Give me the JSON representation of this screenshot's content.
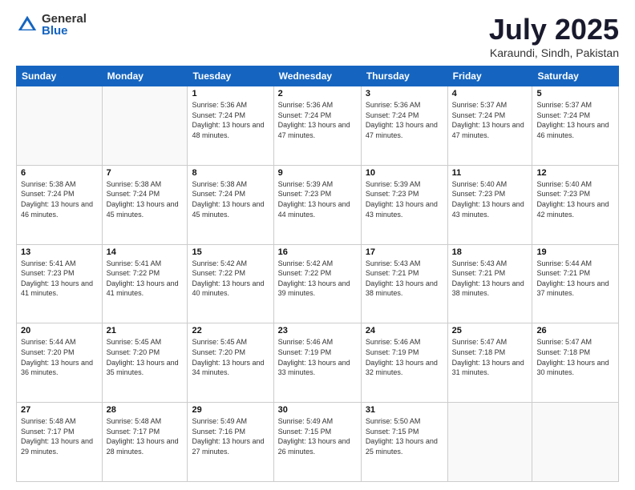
{
  "logo": {
    "general": "General",
    "blue": "Blue"
  },
  "header": {
    "month": "July 2025",
    "location": "Karaundi, Sindh, Pakistan"
  },
  "weekdays": [
    "Sunday",
    "Monday",
    "Tuesday",
    "Wednesday",
    "Thursday",
    "Friday",
    "Saturday"
  ],
  "weeks": [
    [
      {
        "day": "",
        "sunrise": "",
        "sunset": "",
        "daylight": ""
      },
      {
        "day": "",
        "sunrise": "",
        "sunset": "",
        "daylight": ""
      },
      {
        "day": "1",
        "sunrise": "Sunrise: 5:36 AM",
        "sunset": "Sunset: 7:24 PM",
        "daylight": "Daylight: 13 hours and 48 minutes."
      },
      {
        "day": "2",
        "sunrise": "Sunrise: 5:36 AM",
        "sunset": "Sunset: 7:24 PM",
        "daylight": "Daylight: 13 hours and 47 minutes."
      },
      {
        "day": "3",
        "sunrise": "Sunrise: 5:36 AM",
        "sunset": "Sunset: 7:24 PM",
        "daylight": "Daylight: 13 hours and 47 minutes."
      },
      {
        "day": "4",
        "sunrise": "Sunrise: 5:37 AM",
        "sunset": "Sunset: 7:24 PM",
        "daylight": "Daylight: 13 hours and 47 minutes."
      },
      {
        "day": "5",
        "sunrise": "Sunrise: 5:37 AM",
        "sunset": "Sunset: 7:24 PM",
        "daylight": "Daylight: 13 hours and 46 minutes."
      }
    ],
    [
      {
        "day": "6",
        "sunrise": "Sunrise: 5:38 AM",
        "sunset": "Sunset: 7:24 PM",
        "daylight": "Daylight: 13 hours and 46 minutes."
      },
      {
        "day": "7",
        "sunrise": "Sunrise: 5:38 AM",
        "sunset": "Sunset: 7:24 PM",
        "daylight": "Daylight: 13 hours and 45 minutes."
      },
      {
        "day": "8",
        "sunrise": "Sunrise: 5:38 AM",
        "sunset": "Sunset: 7:24 PM",
        "daylight": "Daylight: 13 hours and 45 minutes."
      },
      {
        "day": "9",
        "sunrise": "Sunrise: 5:39 AM",
        "sunset": "Sunset: 7:23 PM",
        "daylight": "Daylight: 13 hours and 44 minutes."
      },
      {
        "day": "10",
        "sunrise": "Sunrise: 5:39 AM",
        "sunset": "Sunset: 7:23 PM",
        "daylight": "Daylight: 13 hours and 43 minutes."
      },
      {
        "day": "11",
        "sunrise": "Sunrise: 5:40 AM",
        "sunset": "Sunset: 7:23 PM",
        "daylight": "Daylight: 13 hours and 43 minutes."
      },
      {
        "day": "12",
        "sunrise": "Sunrise: 5:40 AM",
        "sunset": "Sunset: 7:23 PM",
        "daylight": "Daylight: 13 hours and 42 minutes."
      }
    ],
    [
      {
        "day": "13",
        "sunrise": "Sunrise: 5:41 AM",
        "sunset": "Sunset: 7:23 PM",
        "daylight": "Daylight: 13 hours and 41 minutes."
      },
      {
        "day": "14",
        "sunrise": "Sunrise: 5:41 AM",
        "sunset": "Sunset: 7:22 PM",
        "daylight": "Daylight: 13 hours and 41 minutes."
      },
      {
        "day": "15",
        "sunrise": "Sunrise: 5:42 AM",
        "sunset": "Sunset: 7:22 PM",
        "daylight": "Daylight: 13 hours and 40 minutes."
      },
      {
        "day": "16",
        "sunrise": "Sunrise: 5:42 AM",
        "sunset": "Sunset: 7:22 PM",
        "daylight": "Daylight: 13 hours and 39 minutes."
      },
      {
        "day": "17",
        "sunrise": "Sunrise: 5:43 AM",
        "sunset": "Sunset: 7:21 PM",
        "daylight": "Daylight: 13 hours and 38 minutes."
      },
      {
        "day": "18",
        "sunrise": "Sunrise: 5:43 AM",
        "sunset": "Sunset: 7:21 PM",
        "daylight": "Daylight: 13 hours and 38 minutes."
      },
      {
        "day": "19",
        "sunrise": "Sunrise: 5:44 AM",
        "sunset": "Sunset: 7:21 PM",
        "daylight": "Daylight: 13 hours and 37 minutes."
      }
    ],
    [
      {
        "day": "20",
        "sunrise": "Sunrise: 5:44 AM",
        "sunset": "Sunset: 7:20 PM",
        "daylight": "Daylight: 13 hours and 36 minutes."
      },
      {
        "day": "21",
        "sunrise": "Sunrise: 5:45 AM",
        "sunset": "Sunset: 7:20 PM",
        "daylight": "Daylight: 13 hours and 35 minutes."
      },
      {
        "day": "22",
        "sunrise": "Sunrise: 5:45 AM",
        "sunset": "Sunset: 7:20 PM",
        "daylight": "Daylight: 13 hours and 34 minutes."
      },
      {
        "day": "23",
        "sunrise": "Sunrise: 5:46 AM",
        "sunset": "Sunset: 7:19 PM",
        "daylight": "Daylight: 13 hours and 33 minutes."
      },
      {
        "day": "24",
        "sunrise": "Sunrise: 5:46 AM",
        "sunset": "Sunset: 7:19 PM",
        "daylight": "Daylight: 13 hours and 32 minutes."
      },
      {
        "day": "25",
        "sunrise": "Sunrise: 5:47 AM",
        "sunset": "Sunset: 7:18 PM",
        "daylight": "Daylight: 13 hours and 31 minutes."
      },
      {
        "day": "26",
        "sunrise": "Sunrise: 5:47 AM",
        "sunset": "Sunset: 7:18 PM",
        "daylight": "Daylight: 13 hours and 30 minutes."
      }
    ],
    [
      {
        "day": "27",
        "sunrise": "Sunrise: 5:48 AM",
        "sunset": "Sunset: 7:17 PM",
        "daylight": "Daylight: 13 hours and 29 minutes."
      },
      {
        "day": "28",
        "sunrise": "Sunrise: 5:48 AM",
        "sunset": "Sunset: 7:17 PM",
        "daylight": "Daylight: 13 hours and 28 minutes."
      },
      {
        "day": "29",
        "sunrise": "Sunrise: 5:49 AM",
        "sunset": "Sunset: 7:16 PM",
        "daylight": "Daylight: 13 hours and 27 minutes."
      },
      {
        "day": "30",
        "sunrise": "Sunrise: 5:49 AM",
        "sunset": "Sunset: 7:15 PM",
        "daylight": "Daylight: 13 hours and 26 minutes."
      },
      {
        "day": "31",
        "sunrise": "Sunrise: 5:50 AM",
        "sunset": "Sunset: 7:15 PM",
        "daylight": "Daylight: 13 hours and 25 minutes."
      },
      {
        "day": "",
        "sunrise": "",
        "sunset": "",
        "daylight": ""
      },
      {
        "day": "",
        "sunrise": "",
        "sunset": "",
        "daylight": ""
      }
    ]
  ]
}
